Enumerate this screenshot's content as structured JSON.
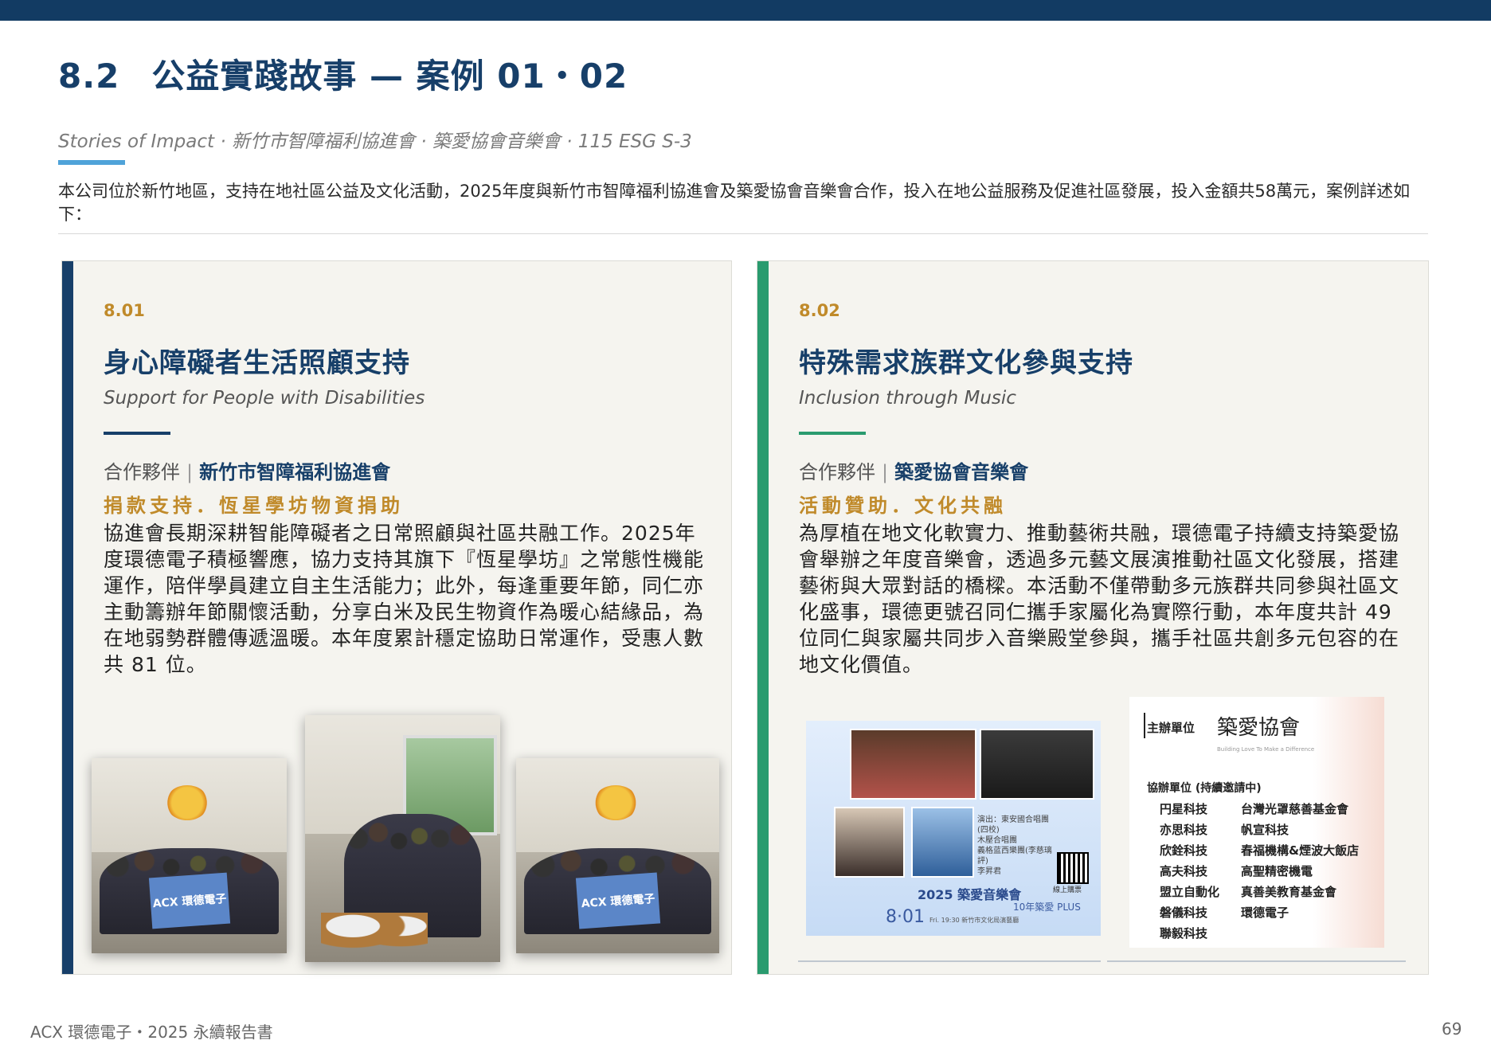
{
  "header": {
    "section_num": "8.2",
    "title": "公益實踐故事 — 案例 01・02",
    "subtitle": "Stories of Impact · 新竹市智障福利協進會 · 築愛協會音樂會 · 115 ESG S-3",
    "intro": "本公司位於新竹地區，支持在地社區公益及文化活動，2025年度與新竹市智障福利協進會及築愛協會音樂會合作，投入在地公益服務及促進社區發展，投入金額共58萬元，案例詳述如下："
  },
  "cards": [
    {
      "code": "8.01",
      "title": "身心障礙者生活照顧支持",
      "subtitle": "Support for People with Disabilities",
      "partner_label": "合作夥伴",
      "partner_sep": "|",
      "partner_name": "新竹市智障福利協進會",
      "tag": "捐款支持．恆星學坊物資捐助",
      "body": "協進會長期深耕智能障礙者之日常照顧與社區共融工作。2025年度環德電子積極響應，協力支持其旗下『恆星學坊』之常態性機能運作，陪伴學員建立自主生活能力；此外，每逢重要年節，同仁亦主動籌辦年節關懷活動，分享白米及民生物資作為暖心結緣品，為在地弱勢群體傳遞溫暖。本年度累計穩定協助日常運作，受惠人數共 81 位。",
      "photo_banner_1": "ACX 環德電子",
      "photo_banner_3": "ACX 環德電子",
      "accent": "#173f69"
    },
    {
      "code": "8.02",
      "title": "特殊需求族群文化參與支持",
      "subtitle": "Inclusion through Music",
      "partner_label": "合作夥伴",
      "partner_sep": "|",
      "partner_name": "築愛協會音樂會",
      "tag": "活動贊助．文化共融",
      "body": "為厚植在地文化軟實力、推動藝術共融，環德電子持續支持築愛協會舉辦之年度音樂會，透過多元藝文展演推動社區文化發展，搭建藝術與大眾對話的橋樑。本活動不僅帶動多元族群共同參與社區文化盛事，環德更號召同仁攜手家屬化為實際行動，本年度共計 49 位同仁與家屬共同步入音樂殿堂參與，攜手社區共創多元包容的在地文化價值。",
      "accent": "#2a9b6f"
    }
  ],
  "poster": {
    "title": "2025 築愛音樂會",
    "subtitle": "10年築愛 PLUS",
    "date": "8·01",
    "date_small": "Fri. 19:30  新竹市文化局演藝廳",
    "info": "演出：東安國合唱團(四校)\n木壓合唱團\n義格蓝西樂團(李慈璃評)\n李昇君",
    "online": "線上購票"
  },
  "sponsor": {
    "host_label": "主辦單位",
    "logo": "築愛協會",
    "logo_sub": "Building Love To Make a Difference",
    "co_label": "協辦單位 (持續邀請中)",
    "col1": [
      "円星科技",
      "亦思科技",
      "欣銓科技",
      "高夫科技",
      "盟立自動化",
      "磐儀科技",
      "聯毅科技"
    ],
    "col2": [
      "台灣光罩慈善基金會",
      "帆宣科技",
      "春福機構&煙波大飯店",
      "高聖精密機電",
      "真善美教育基金會",
      "環德電子"
    ]
  },
  "footer": {
    "text": "ACX 環德電子・2025 永續報告書",
    "page": "69"
  }
}
